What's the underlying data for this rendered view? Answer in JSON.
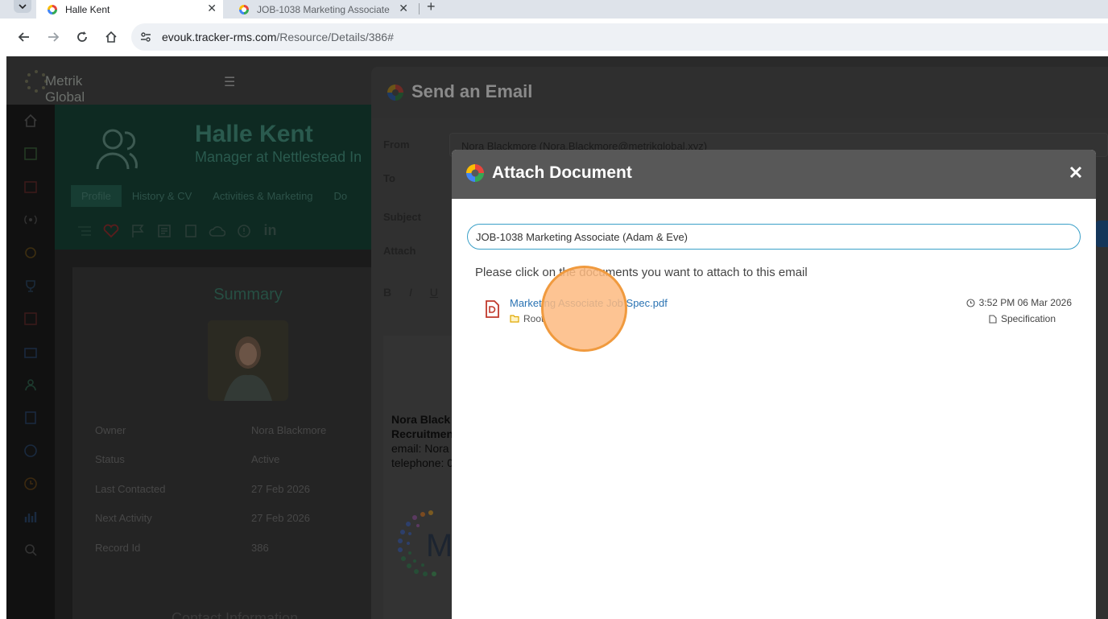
{
  "browser": {
    "tabs": [
      {
        "title": "Halle Kent",
        "active": true
      },
      {
        "title": "JOB-1038 Marketing Associate",
        "active": false
      }
    ],
    "url_host": "evouk.tracker-rms.com",
    "url_path": "/Resource/Details/386#"
  },
  "app": {
    "logo_text": "Metrik Global",
    "profile": {
      "name": "Halle Kent",
      "subtitle": "Manager at Nettlestead In",
      "tabs": [
        "Profile",
        "History & CV",
        "Activities & Marketing",
        "Do"
      ]
    },
    "summary": {
      "title": "Summary",
      "fields": [
        {
          "label": "Owner",
          "value": "Nora Blackmore"
        },
        {
          "label": "Status",
          "value": "Active"
        },
        {
          "label": "Last Contacted",
          "value": "27 Feb 2026"
        },
        {
          "label": "Next Activity",
          "value": "27 Feb 2026"
        },
        {
          "label": "Record Id",
          "value": "386"
        }
      ],
      "contact_title": "Contact Information"
    }
  },
  "email": {
    "title": "Send an Email",
    "labels": {
      "from": "From",
      "to": "To",
      "subject": "Subject",
      "attach": "Attach"
    },
    "from_value": "Nora Blackmore (Nora.Blackmore@metrikglobal.xyz)",
    "signature": {
      "name": "Nora Black",
      "role": "Recruitmen",
      "email": "email: Nora",
      "phone": "telephone: 0"
    }
  },
  "modal": {
    "title": "Attach Document",
    "search_value": "JOB-1038 Marketing Associate (Adam & Eve)",
    "instruction": "Please click on the documents you want to attach to this email",
    "documents": [
      {
        "name": "Marketing Associate Job Spec.pdf",
        "folder": "Root",
        "timestamp": "3:52 PM 06 Mar 2026",
        "type": "Specification"
      }
    ]
  },
  "colors": {
    "modal_header": "#585858",
    "link": "#2a73b3",
    "search_border": "#3aa0c8",
    "click_indicator": "#f09a3e"
  }
}
